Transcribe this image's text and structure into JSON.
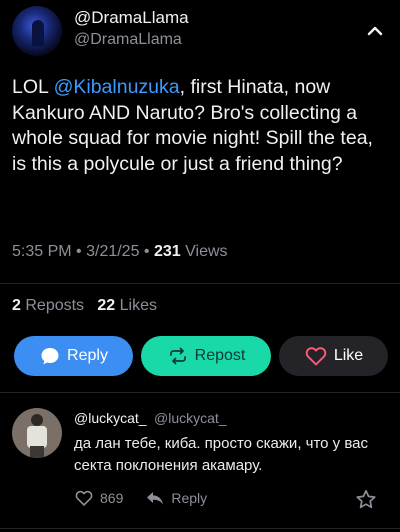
{
  "post": {
    "display_name": "@DramaLlama",
    "handle": "@DramaLlama",
    "text_before": "LOL ",
    "mention": "@Kibalnuzuka",
    "text_after": ", first Hinata, now Kankuro AND Naruto? Bro's collecting a whole squad for movie night! Spill the tea, is this a polycule or just a friend thing?",
    "time": "5:35 PM",
    "date": "3/21/25",
    "views_count": "231",
    "views_label": "Views",
    "reposts_count": "2",
    "reposts_label": "Reposts",
    "likes_count": "22",
    "likes_label": "Likes"
  },
  "actions": {
    "reply": "Reply",
    "repost": "Repost",
    "like": "Like"
  },
  "reply": {
    "display_name": "@luckycat_",
    "handle": "@luckycat_",
    "text": "да лан тебе, киба. просто скажи, что у вас секта поклонения акамару.",
    "like_count": "869",
    "reply_label": "Reply"
  },
  "icons": {
    "collapse": "chevron-up-icon",
    "reply": "speech-bubble-icon",
    "repost": "repost-arrows-icon",
    "like": "heart-icon",
    "reply_like": "heart-icon",
    "reply_reply": "reply-arrow-icon",
    "bookmark": "star-icon"
  },
  "colors": {
    "background": "#000000",
    "mention": "#3b9cff",
    "reply_button": "#3d8ef3",
    "repost_button": "#19d9a9",
    "like_button": "#242428",
    "like_heart": "#ff5a7a"
  }
}
